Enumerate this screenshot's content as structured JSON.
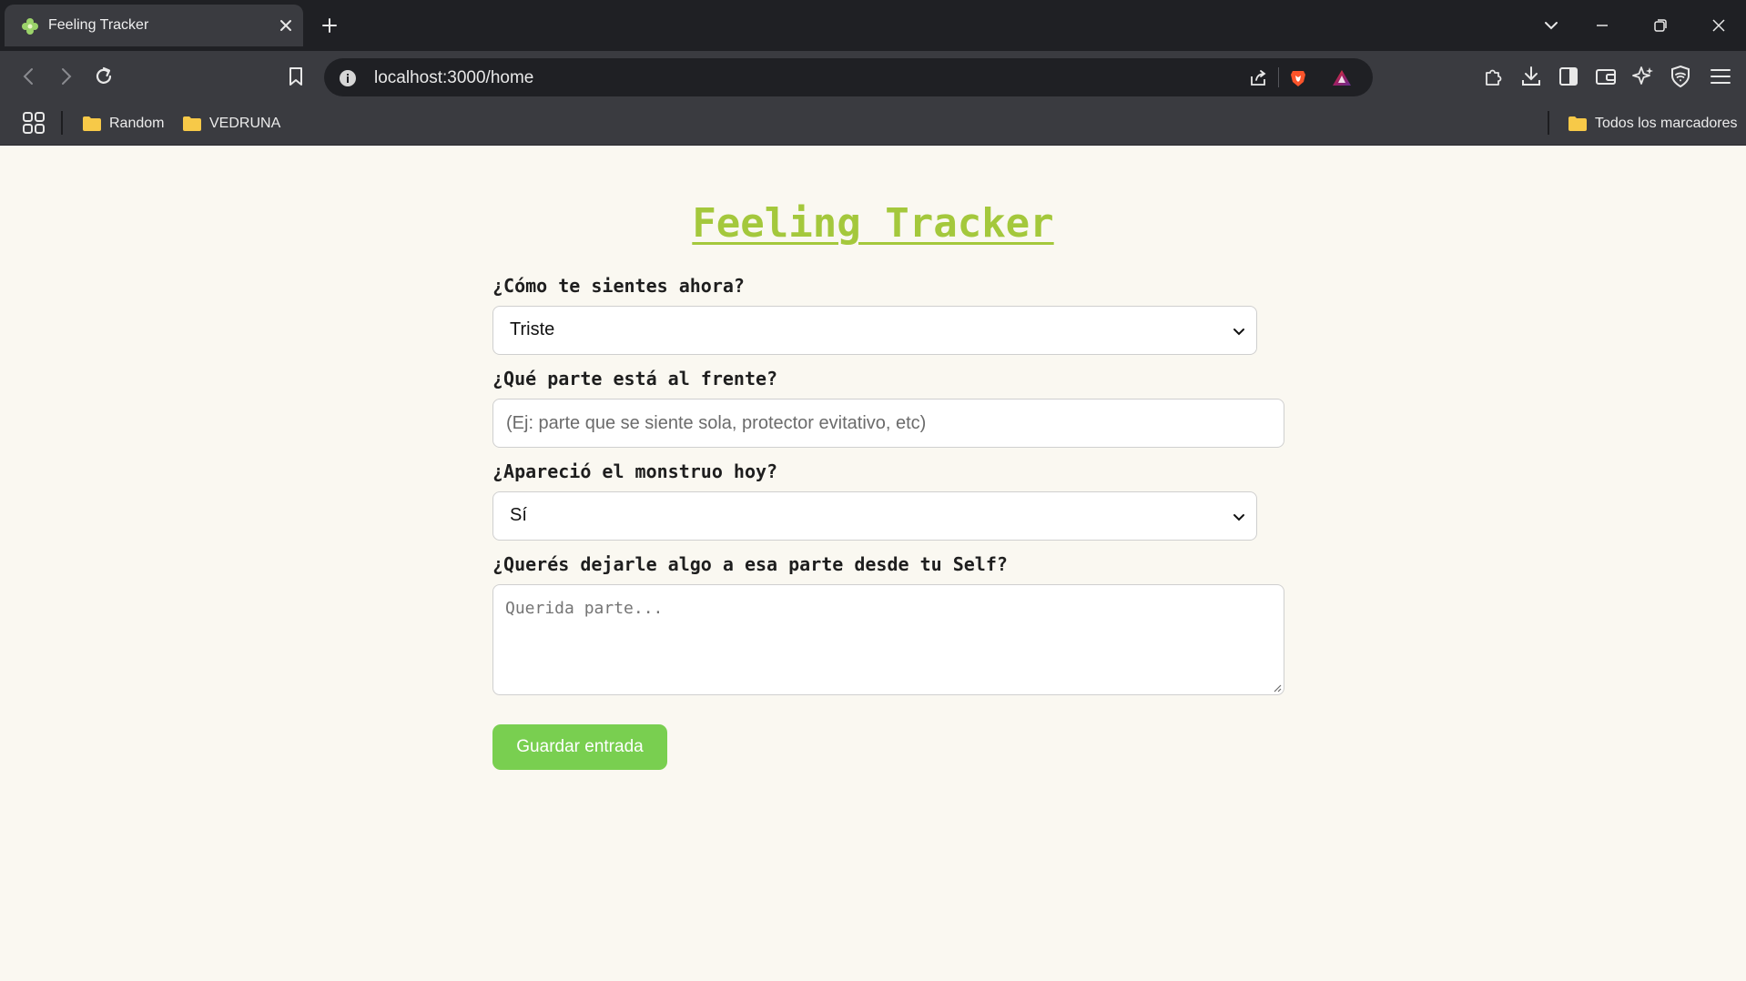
{
  "browser": {
    "tab_title": "Feeling Tracker",
    "url": "localhost:3000/home",
    "bookmarks": [
      {
        "label": "Random",
        "icon": "folder-icon"
      },
      {
        "label": "VEDRUNA",
        "icon": "folder-icon"
      }
    ],
    "all_bookmarks_label": "Todos los marcadores"
  },
  "page": {
    "title": "Feeling Tracker",
    "feeling_label": "¿Cómo te sientes ahora?",
    "feeling_value": "Triste",
    "part_label": "¿Qué parte está al frente?",
    "part_placeholder": "(Ej: parte que se siente sola, protector evitativo, etc)",
    "monster_label": "¿Apareció el monstruo hoy?",
    "monster_value": "Sí",
    "message_label": "¿Querés dejarle algo a esa parte desde tu Self?",
    "message_placeholder": "Querida parte...",
    "save_label": "Guardar entrada"
  },
  "colors": {
    "title": "#a4c83c",
    "button": "#79cf50",
    "background": "#faf8f1"
  }
}
